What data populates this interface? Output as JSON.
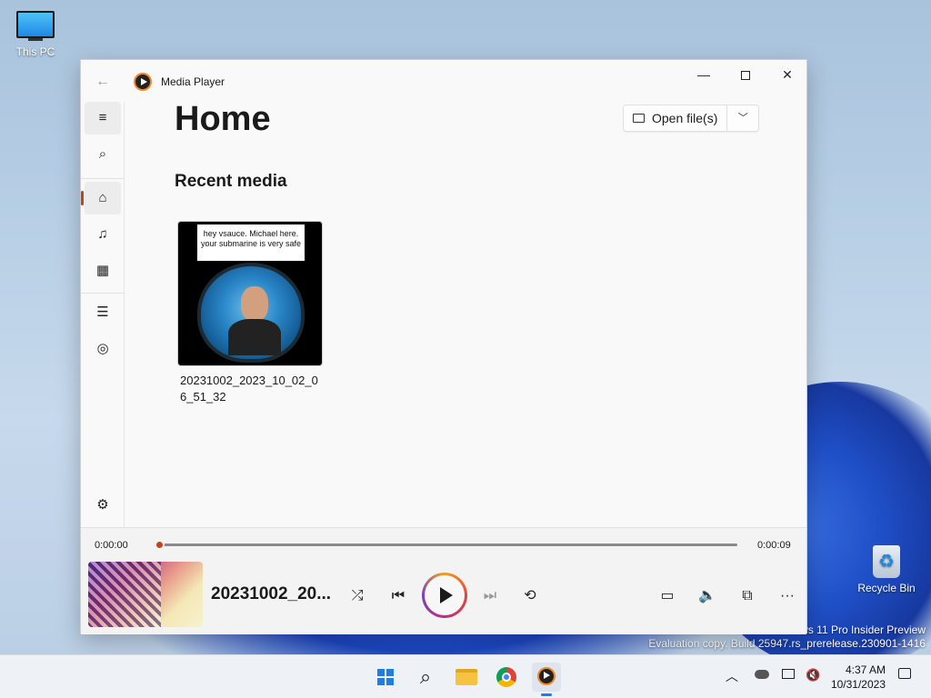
{
  "desktop": {
    "icons": [
      {
        "label": "This PC"
      },
      {
        "label": "Recycle Bin"
      }
    ],
    "watermark_line1": "ws 11 Pro Insider Preview",
    "watermark_line2": "Evaluation copy. Build 25947.rs_prerelease.230901-1416"
  },
  "window": {
    "app_title": "Media Player",
    "controls": {
      "minimize": "—",
      "close": "✕"
    },
    "back_icon": "←"
  },
  "nav": {
    "items": [
      {
        "name": "menu",
        "icon": "≡"
      },
      {
        "name": "search",
        "icon": "⌕"
      },
      {
        "name": "home",
        "icon": "⌂",
        "active": true
      },
      {
        "name": "music",
        "icon": "♫"
      },
      {
        "name": "video",
        "icon": "▦"
      },
      {
        "name": "playlists",
        "icon": "☰"
      },
      {
        "name": "play-queue",
        "icon": "◎"
      },
      {
        "name": "settings",
        "icon": "⚙"
      }
    ]
  },
  "main": {
    "page_title": "Home",
    "open_files_label": "Open file(s)",
    "open_dropdown_icon": "﹀",
    "section_title": "Recent media",
    "recent": [
      {
        "name_line1": "20231002_2023_10_02_0",
        "name_line2": "6_51_32",
        "thumb_caption_line1": "hey vsauce. Michael here.",
        "thumb_caption_line2": "your submarine is very safe"
      }
    ]
  },
  "player": {
    "current_time": "0:00:00",
    "total_time": "0:00:09",
    "progress": 0.0,
    "now_playing_title": "20231002_20...",
    "controls": {
      "shuffle": "⤮",
      "previous": "⏮",
      "next": "⏭",
      "repeat": "⟲",
      "captions": "▭",
      "volume": "🔈",
      "miniplayer": "⧉",
      "more": "···"
    }
  },
  "taskbar": {
    "search_icon": "⌕",
    "chevron": "︿",
    "time": "4:37 AM",
    "date": "10/31/2023"
  }
}
